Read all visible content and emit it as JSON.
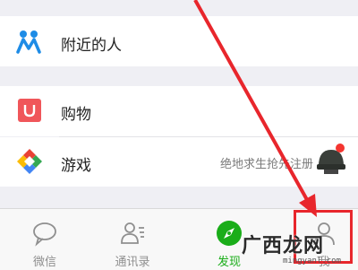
{
  "nearby": {
    "label": "附近的人",
    "icon": "people-nearby-icon"
  },
  "shopping": {
    "label": "购物",
    "icon": "shopping-bag-icon"
  },
  "games": {
    "label": "游戏",
    "icon": "game-diamond-icon",
    "promo_text": "绝地求生抢先注册"
  },
  "tabbar": {
    "tabs": [
      {
        "label": "微信",
        "icon": "chat-bubble-icon"
      },
      {
        "label": "通讯录",
        "icon": "contacts-icon"
      },
      {
        "label": "发现",
        "icon": "compass-icon"
      },
      {
        "label": "我",
        "icon": "person-icon"
      }
    ],
    "active_index": 2
  },
  "annotation": {
    "arrow_color": "#e8262c",
    "box_color": "#e8262c"
  },
  "watermark": {
    "text": "广西龙网",
    "url": "mingyanl.com"
  },
  "colors": {
    "active_green": "#1aad19",
    "badge_red": "#f43530",
    "background": "#efeff4"
  }
}
